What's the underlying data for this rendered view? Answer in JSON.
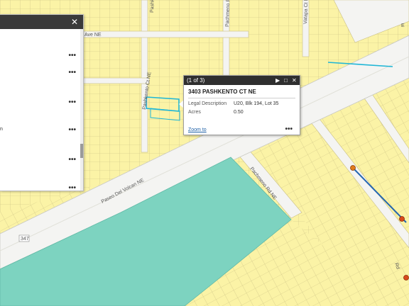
{
  "map": {
    "roads": {
      "ave_ne": "Ave NE",
      "pashkento_ct": "Pashkento Ct NE",
      "pachmeno_top": "Pachmeno R",
      "vatapa_ct": "Vatapa Ct NE",
      "paseo_del_volcan": "Paseo Del Volcan NE",
      "pachmeno_rd": "Pachmeno Rd NE",
      "route_shield": "347",
      "far_right_label": "E",
      "bottom_right_label": "Rd"
    },
    "colors": {
      "parcel_fill": "#fbf3a6",
      "parcel_line": "#c9bf83",
      "water_fill": "#7dd3c0",
      "road_fill": "#f4f4f2",
      "selection": "#1fb6d6",
      "pipeline": "#2566b0"
    }
  },
  "side_panel": {
    "close_glyph": "✕",
    "more_glyph": "•••",
    "truncated_text": "n"
  },
  "popup": {
    "count": "(1 of 3)",
    "next_glyph": "▶",
    "maximize_glyph": "□",
    "close_glyph": "✕",
    "title": "3403 PASHKENTO CT NE",
    "rows": [
      {
        "label": "Legal Description",
        "value": "U20, Blk 194, Lot 35"
      },
      {
        "label": "Acres",
        "value": "0.50"
      }
    ],
    "zoom_link": "Zoom to",
    "more_glyph": "•••"
  }
}
